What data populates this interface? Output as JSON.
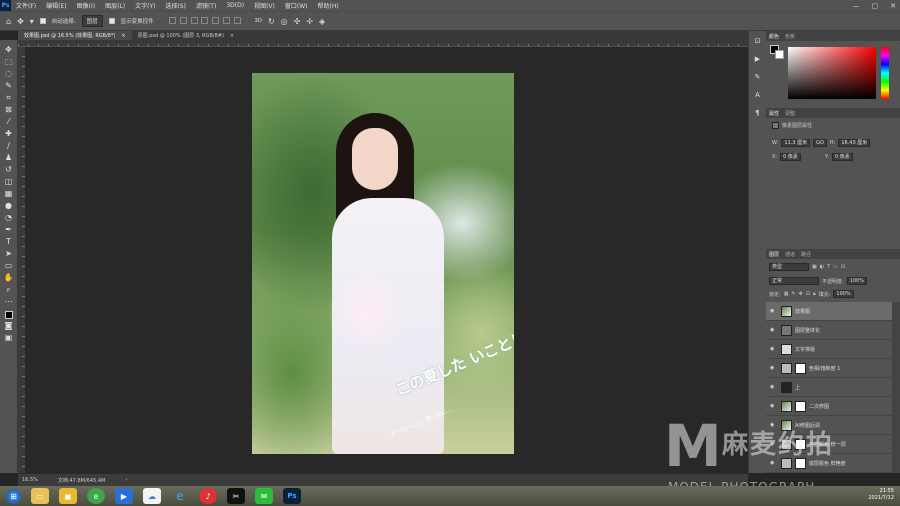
{
  "app": {
    "logo": "Ps"
  },
  "menu": [
    "文件(F)",
    "编辑(E)",
    "图像(I)",
    "图层(L)",
    "文字(Y)",
    "选择(S)",
    "滤镜(T)",
    "3D(D)",
    "视图(V)",
    "窗口(W)",
    "帮助(H)"
  ],
  "window_controls": {
    "minimize": "—",
    "restore": "▢",
    "close": "✕"
  },
  "options": {
    "auto_select_label": "自动选择:",
    "auto_select_value": "图层",
    "show_transform_label": "显示变换控件"
  },
  "tabs": [
    {
      "label": "效果图.psd @ 16.5% (效果图, RGB/8*)",
      "close": "×",
      "active": true
    },
    {
      "label": "原图.psd @ 100% (图层 3, RGB/8#)",
      "close": "×",
      "active": false
    }
  ],
  "photo": {
    "title_text": "この夏した いこと！",
    "sub_text": "…やりたいこと、思い出に…"
  },
  "panels": {
    "color_tabs": [
      "颜色",
      "色板"
    ],
    "props_tabs": [
      "属性",
      "调整"
    ],
    "props_title": "像素图层属性",
    "width_label": "W:",
    "width_value": "11.3 厘米",
    "link_label": "GO",
    "height_label": "H:",
    "height_value": "16.43 厘米",
    "x_label": "X:",
    "x_value": "0 像素",
    "y_label": "Y:",
    "y_value": "0 像素",
    "layers_tabs": [
      "图层",
      "通道",
      "路径"
    ],
    "kind_label": "类型",
    "blend_mode": "正常",
    "opacity_label": "不透明度:",
    "opacity_value": "100%",
    "lock_label": "锁定:",
    "fill_label": "填充:",
    "fill_value": "100%",
    "layers": [
      {
        "name": "效果图",
        "thumb": "photo",
        "selected": true
      },
      {
        "name": "图层整体化",
        "thumb": "gray",
        "selected": false
      },
      {
        "name": "文字排版",
        "thumb": "white",
        "selected": false
      },
      {
        "name": "色相/饱和度 1",
        "thumb": "white",
        "selected": false
      },
      {
        "name": "上",
        "thumb": "dark",
        "selected": false
      },
      {
        "name": "二次修图",
        "thumb": "photo",
        "selected": false
      },
      {
        "name": "AI修图后调",
        "thumb": "photo",
        "selected": false
      },
      {
        "name": "可选颜色 统一调",
        "thumb": "white",
        "selected": false
      },
      {
        "name": "底层颜色 鲜艳度",
        "thumb": "white",
        "selected": false
      }
    ]
  },
  "status": {
    "zoom": "16.5%",
    "doc": "文档:47.8M/645.4M"
  },
  "watermark": {
    "logo_letter": "M",
    "chinese": "麻麦约拍",
    "english": "MODEL PHOTOGRAPH"
  },
  "clock": {
    "time": "21:55",
    "date": "2021/7/12"
  }
}
